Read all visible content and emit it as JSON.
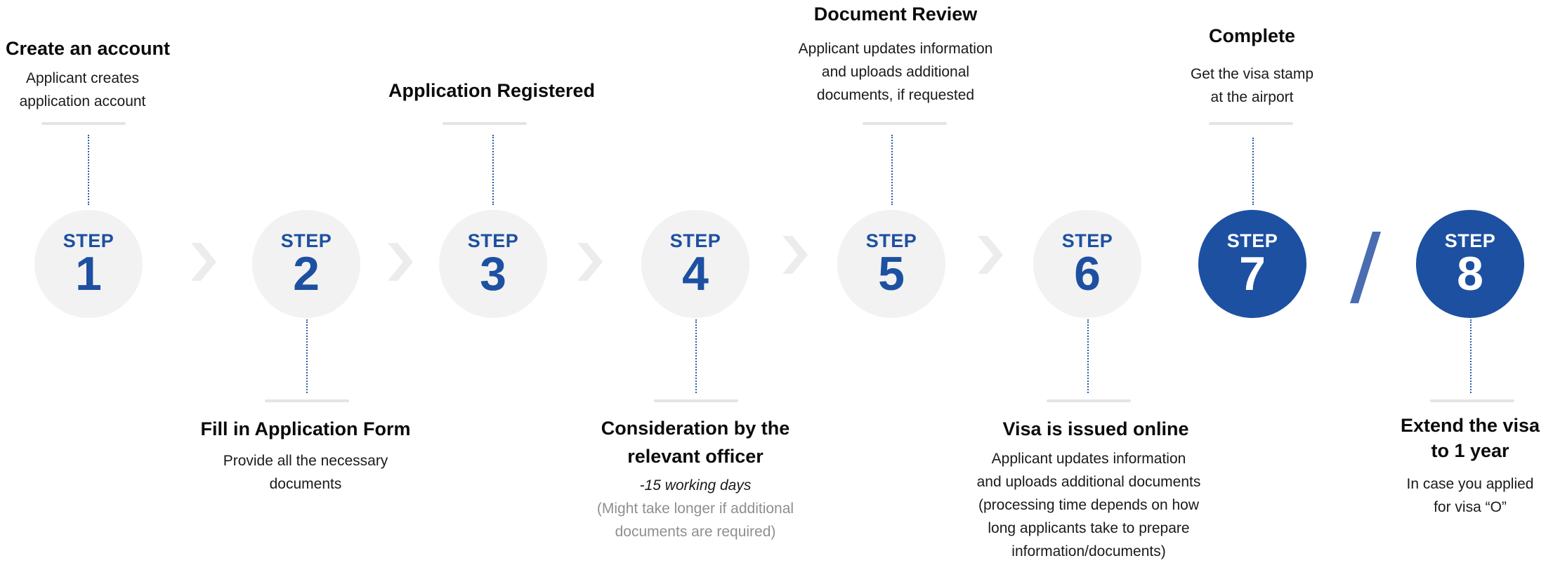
{
  "steps": [
    {
      "step_label": "STEP",
      "number": "1",
      "title": "Create an account",
      "description": [
        "Applicant creates",
        "application account"
      ]
    },
    {
      "step_label": "STEP",
      "number": "2",
      "title": "Fill in Application Form",
      "description": [
        "Provide all the necessary",
        "documents"
      ]
    },
    {
      "step_label": "STEP",
      "number": "3",
      "title": "Application Registered",
      "description": []
    },
    {
      "step_label": "STEP",
      "number": "4",
      "title_lines": [
        "Consideration by the",
        "relevant officer"
      ],
      "duration": "-15 working days",
      "note": [
        "(Might take longer if additional",
        "documents are required)"
      ]
    },
    {
      "step_label": "STEP",
      "number": "5",
      "title": "Document Review",
      "description": [
        "Applicant updates information",
        "and uploads additional",
        "documents, if requested"
      ]
    },
    {
      "step_label": "STEP",
      "number": "6",
      "title": "Visa is issued online",
      "description": [
        "Applicant updates information",
        "and uploads additional documents",
        "(processing time depends on how",
        "long applicants take to prepare",
        "information/documents)"
      ]
    },
    {
      "step_label": "STEP",
      "number": "7",
      "title": "Complete",
      "description": [
        "Get the visa stamp",
        "at the airport"
      ]
    },
    {
      "step_label": "STEP",
      "number": "8",
      "title_lines": [
        "Extend the visa",
        "to 1 year"
      ],
      "description": [
        "In case you applied",
        "for visa “O”"
      ]
    }
  ],
  "colors": {
    "accent_blue": "#1d50a0",
    "circle_gray": "#f2f2f2",
    "chevron_gray": "#ececec",
    "connector_bar": "#e4e4e4",
    "note_gray": "#8f8f8f"
  },
  "icons": {
    "separator": "chevron-right-icon",
    "or_divider": "slash-icon"
  }
}
